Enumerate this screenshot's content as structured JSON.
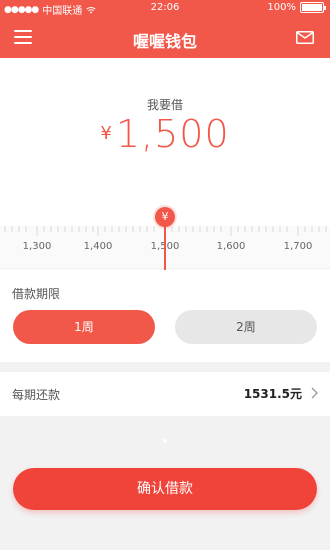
{
  "status_bar": {
    "carrier": "中国联通",
    "time": "22:06",
    "battery": "100%"
  },
  "header": {
    "title": "喔喔钱包"
  },
  "loan": {
    "amount_label": "我要借",
    "currency_symbol": "¥",
    "amount": "1,500"
  },
  "ruler": {
    "ticks": [
      "1,300",
      "1,400",
      "1,500",
      "1,600",
      "1,700"
    ],
    "pointer_symbol": "¥"
  },
  "term": {
    "label": "借款期限",
    "options": [
      "1周",
      "2周"
    ],
    "selected": "1周"
  },
  "repayment": {
    "label": "每期还款",
    "value": "1531.5元"
  },
  "confirm_label": "确认借款",
  "colors": {
    "accent": "#f1584a",
    "confirm": "#f0443a",
    "background_gray": "#f2f2f2"
  }
}
